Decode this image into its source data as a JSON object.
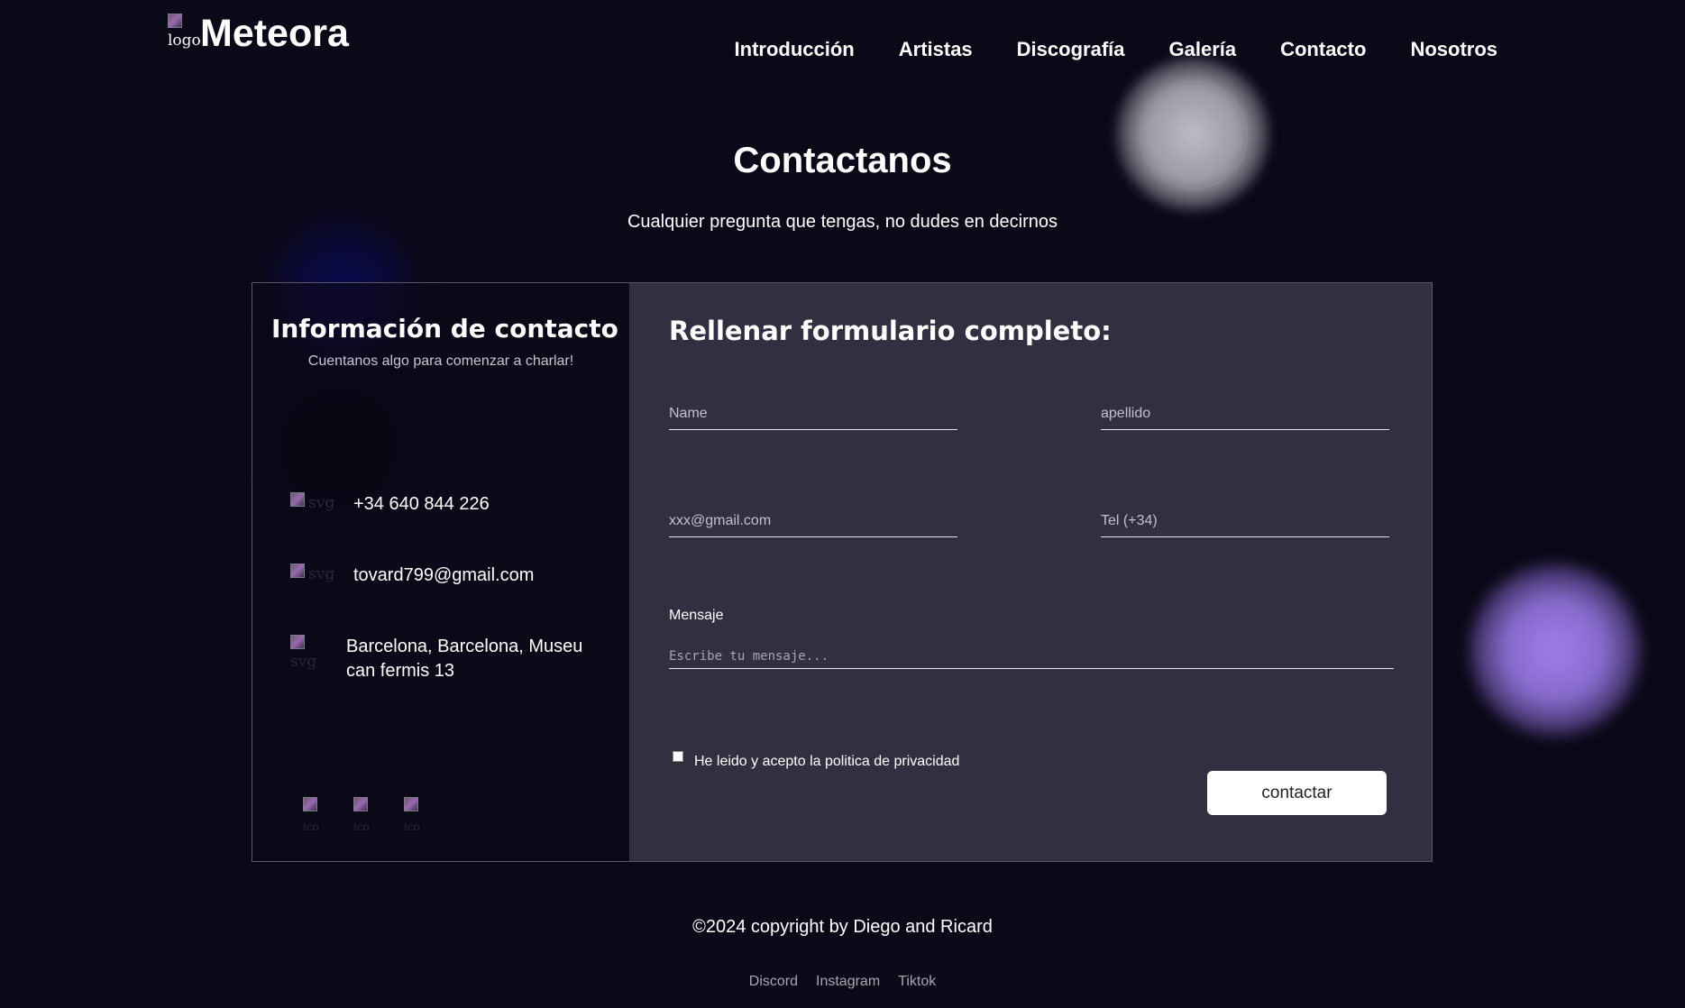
{
  "header": {
    "logo_alt": "logo",
    "brand": "Meteora",
    "nav": [
      "Introducción",
      "Artistas",
      "Discografía",
      "Galería",
      "Contacto",
      "Nosotros"
    ]
  },
  "hero": {
    "title": "Contactanos",
    "subtitle": "Cualquier pregunta que tengas, no dudes en decirnos"
  },
  "info": {
    "title": "Información de contacto",
    "subtitle": "Cuentanos algo para comenzar a charlar!",
    "items": [
      {
        "icon": "phone-icon",
        "icon_alt": "svg",
        "text": "+34 640 844 226"
      },
      {
        "icon": "email-icon",
        "icon_alt": "svg",
        "text": "tovard799@gmail.com"
      },
      {
        "icon": "location-icon",
        "icon_alt": "svg",
        "text": "Barcelona, Barcelona, Museu can fermis 13"
      }
    ],
    "social_alt": [
      "ico",
      "ico",
      "ico"
    ]
  },
  "form": {
    "title": "Rellenar formulario completo:",
    "name_placeholder": "Name",
    "lastname_placeholder": "apellido",
    "email_placeholder": "xxx@gmail.com",
    "phone_placeholder": "Tel (+34)",
    "message_label": "Mensaje",
    "message_placeholder": "Escribe tu mensaje...",
    "privacy_label": "He leido y acepto la politica de privacidad",
    "submit_label": "contactar"
  },
  "footer": {
    "copyright": "©2024 copyright by Diego and Ricard",
    "links": [
      "Discord",
      "Instagram",
      "Tiktok"
    ]
  },
  "colors": {
    "background": "#0b0818",
    "panel": "#332f40",
    "accent_purple": "#9a7ae0"
  }
}
